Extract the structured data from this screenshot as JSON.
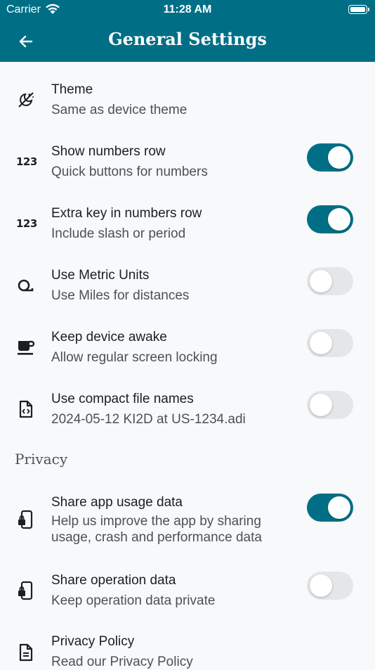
{
  "status_bar": {
    "carrier": "Carrier",
    "time": "11:28 AM"
  },
  "app_bar": {
    "title": "General Settings"
  },
  "settings": [
    {
      "icon": "theme-icon",
      "title": "Theme",
      "subtitle": "Same as device theme"
    },
    {
      "icon": "numbers-icon",
      "title": "Show numbers row",
      "subtitle": "Quick buttons for numbers",
      "toggle": true
    },
    {
      "icon": "numbers-icon",
      "title": "Extra key in numbers row",
      "subtitle": "Include slash or period",
      "toggle": true
    },
    {
      "icon": "measure-icon",
      "title": "Use Metric Units",
      "subtitle": "Use Miles for distances",
      "toggle": false
    },
    {
      "icon": "coffee-icon",
      "title": "Keep device awake",
      "subtitle": "Allow regular screen locking",
      "toggle": false
    },
    {
      "icon": "code-file-icon",
      "title": "Use compact file names",
      "subtitle": "2024-05-12 KI2D at US-1234.adi",
      "toggle": false
    }
  ],
  "privacy": {
    "header": "Privacy",
    "items": [
      {
        "icon": "phone-lock-icon",
        "title": "Share app usage data",
        "subtitle": "Help us improve the app by sharing usage, crash and performance data",
        "toggle": true
      },
      {
        "icon": "phone-lock-icon",
        "title": "Share operation data",
        "subtitle": "Keep operation data private",
        "toggle": false
      },
      {
        "icon": "document-icon",
        "title": "Privacy Policy",
        "subtitle": "Read our Privacy Policy"
      }
    ]
  },
  "colors": {
    "primary": "#006f86",
    "background": "#f7f9fa",
    "toggle_off": "#e4e7ea"
  }
}
